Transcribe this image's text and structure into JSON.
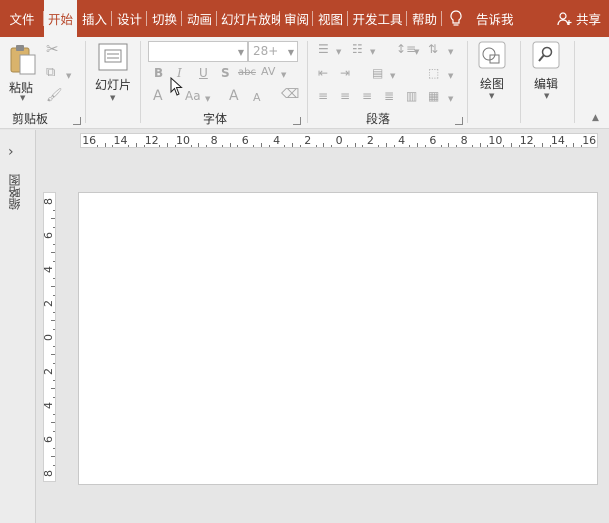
{
  "tabs": [
    {
      "label": "文件",
      "active": false
    },
    {
      "label": "开始",
      "active": true
    },
    {
      "label": "插入",
      "active": false
    },
    {
      "label": "设计",
      "active": false
    },
    {
      "label": "切换",
      "active": false
    },
    {
      "label": "动画",
      "active": false
    },
    {
      "label": "幻灯片放映",
      "active": false
    },
    {
      "label": "审阅",
      "active": false
    },
    {
      "label": "视图",
      "active": false
    },
    {
      "label": "开发工具",
      "active": false
    },
    {
      "label": "帮助",
      "active": false
    }
  ],
  "tell_me": "告诉我",
  "share": "共享",
  "ribbon": {
    "clipboard": {
      "paste": "粘贴",
      "group": "剪贴板"
    },
    "slides": {
      "new_slide": "幻灯片"
    },
    "font": {
      "group": "字体",
      "font_name": "",
      "font_size": "28+",
      "bold": "B",
      "italic": "I",
      "underline": "U",
      "shadow": "S",
      "strike": "abc",
      "spacing": "AV",
      "font_color": "A",
      "change_case": "Aa",
      "grow": "A",
      "shrink": "A"
    },
    "paragraph": {
      "group": "段落"
    },
    "drawing": {
      "label": "绘图"
    },
    "editing": {
      "label": "编辑"
    }
  },
  "sidebar": {
    "label": "缩略图",
    "expand": "›"
  },
  "ruler": {
    "h_labels": [
      "16",
      "14",
      "12",
      "10",
      "8",
      "6",
      "4",
      "2",
      "0",
      "2",
      "4",
      "6",
      "8",
      "10",
      "12",
      "14",
      "16"
    ],
    "v_labels": [
      "8",
      "6",
      "4",
      "2",
      "0",
      "2",
      "4",
      "6",
      "8"
    ]
  },
  "colors": {
    "accent": "#b7472a",
    "ribbon": "#f3f3f3",
    "workspace": "#e6e6e6"
  }
}
